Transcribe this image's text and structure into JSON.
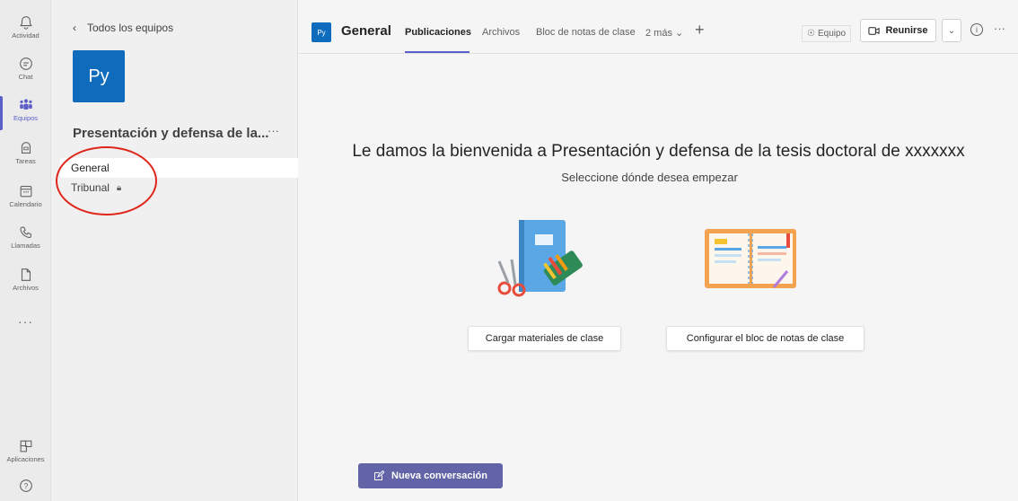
{
  "rail": {
    "items": [
      {
        "label": "Actividad",
        "icon": "bell-icon"
      },
      {
        "label": "Chat",
        "icon": "chat-icon"
      },
      {
        "label": "Equipos",
        "icon": "teams-icon",
        "active": true
      },
      {
        "label": "Tareas",
        "icon": "assignments-icon"
      },
      {
        "label": "Calendario",
        "icon": "calendar-icon"
      },
      {
        "label": "Llamadas",
        "icon": "phone-icon"
      },
      {
        "label": "Archivos",
        "icon": "file-icon"
      }
    ],
    "more": "···",
    "apps_label": "Aplicaciones",
    "help": "?"
  },
  "team_panel": {
    "back_label": "Todos los equipos",
    "avatar_text": "Py",
    "team_name": "Presentación y defensa de la...",
    "team_more": "···",
    "channels": [
      {
        "name": "General",
        "active": true
      },
      {
        "name": "Tribunal",
        "private": true
      }
    ]
  },
  "header": {
    "avatar_text": "Py",
    "channel_title": "General",
    "tabs": [
      {
        "label": "Publicaciones",
        "active": true
      },
      {
        "label": "Archivos"
      },
      {
        "label": "Bloc de notas de clase"
      },
      {
        "label": "2 más ⌄"
      }
    ],
    "add_tab": "+",
    "team_tag": "Equipo",
    "meet_label": "Reunirse",
    "meet_dropdown": "⌄",
    "info": "i",
    "more": "···"
  },
  "main": {
    "welcome_title": "Le damos la bienvenida a Presentación y defensa de la tesis doctoral de xxxxxxx",
    "welcome_subtitle": "Seleccione dónde desea empezar",
    "upload_button": "Cargar materiales de clase",
    "notebook_button": "Configurar el bloc de notas de clase",
    "new_conversation": "Nueva conversación"
  },
  "colors": {
    "accent": "#5b5fc7",
    "brand_blue": "#0f6cbd",
    "annotation_red": "#e0261b",
    "new_conv_bg": "#6264a7"
  }
}
